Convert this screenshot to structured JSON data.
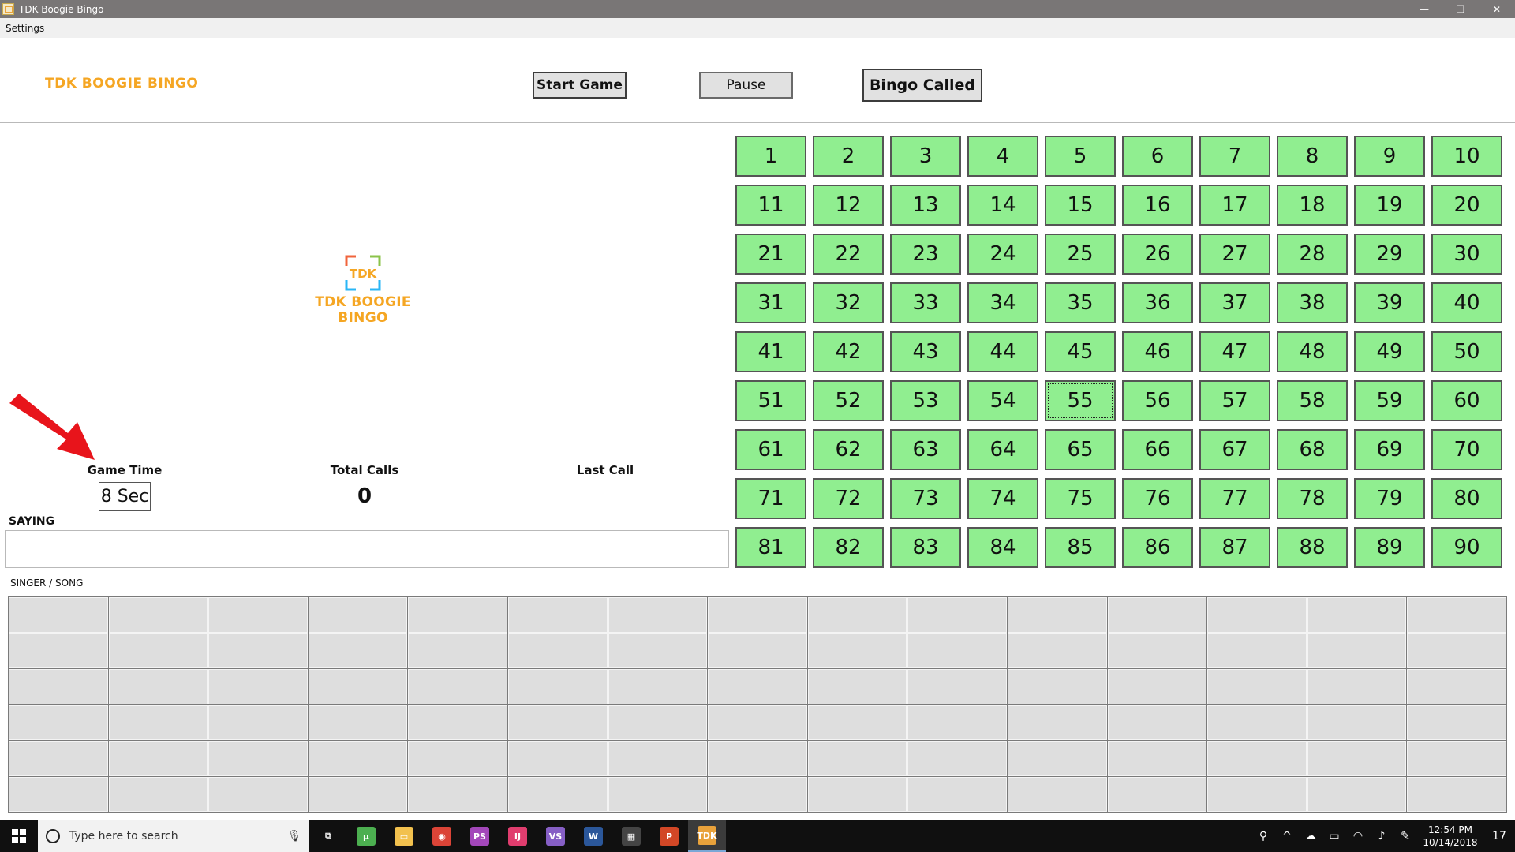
{
  "window": {
    "title": "TDK Boogie Bingo",
    "minimize": "—",
    "restore": "❐",
    "close": "✕"
  },
  "menu": {
    "settings": "Settings"
  },
  "header": {
    "brand": "TDK BOOGIE BINGO",
    "start_label": "Start Game",
    "pause_label": "Pause",
    "bingo_label": "Bingo Called"
  },
  "logo": {
    "mark_text": "TDK",
    "brand": "TDK BOOGIE BINGO"
  },
  "stats": {
    "game_time_label": "Game Time",
    "game_time_value": "8 Sec",
    "total_calls_label": "Total Calls",
    "total_calls_value": "0",
    "last_call_label": "Last Call",
    "last_call_value": ""
  },
  "saying": {
    "label": "SAYING",
    "value": ""
  },
  "singer_song": {
    "label": "SINGER / SONG",
    "rows": 6,
    "cols": 15
  },
  "board": {
    "numbers": [
      1,
      2,
      3,
      4,
      5,
      6,
      7,
      8,
      9,
      10,
      11,
      12,
      13,
      14,
      15,
      16,
      17,
      18,
      19,
      20,
      21,
      22,
      23,
      24,
      25,
      26,
      27,
      28,
      29,
      30,
      31,
      32,
      33,
      34,
      35,
      36,
      37,
      38,
      39,
      40,
      41,
      42,
      43,
      44,
      45,
      46,
      47,
      48,
      49,
      50,
      51,
      52,
      53,
      54,
      55,
      56,
      57,
      58,
      59,
      60,
      61,
      62,
      63,
      64,
      65,
      66,
      67,
      68,
      69,
      70,
      71,
      72,
      73,
      74,
      75,
      76,
      77,
      78,
      79,
      80,
      81,
      82,
      83,
      84,
      85,
      86,
      87,
      88,
      89,
      90
    ],
    "focused": 55,
    "cell_color": "#90ee90"
  },
  "taskbar": {
    "search_placeholder": "Type here to search",
    "apps": [
      {
        "name": "task-view-icon",
        "glyph": "⧉",
        "color": "#101010"
      },
      {
        "name": "utorrent-icon",
        "glyph": "µ",
        "color": "#4caf50"
      },
      {
        "name": "file-explorer-icon",
        "glyph": "▭",
        "color": "#f2c14e"
      },
      {
        "name": "chrome-icon",
        "glyph": "◉",
        "color": "#db4437"
      },
      {
        "name": "phpstorm-icon",
        "glyph": "PS",
        "color": "#a347ba"
      },
      {
        "name": "intellij-icon",
        "glyph": "IJ",
        "color": "#e03d6e"
      },
      {
        "name": "visual-studio-icon",
        "glyph": "VS",
        "color": "#865fc5"
      },
      {
        "name": "word-icon",
        "glyph": "W",
        "color": "#2b579a"
      },
      {
        "name": "calculator-icon",
        "glyph": "▦",
        "color": "#444444"
      },
      {
        "name": "powerpoint-icon",
        "glyph": "P",
        "color": "#d24726"
      },
      {
        "name": "tdk-bingo-icon",
        "glyph": "TDK",
        "color": "#e9a23b"
      }
    ],
    "time": "12:54 PM",
    "date": "10/14/2018",
    "notifications": "17"
  }
}
